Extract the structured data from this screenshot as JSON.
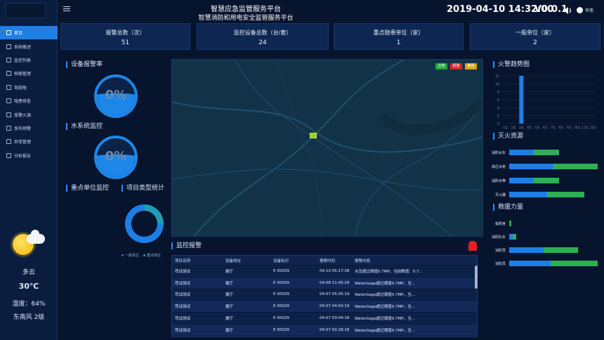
{
  "sidebar": {
    "items": [
      {
        "label": "首页",
        "active": true
      },
      {
        "label": "系统概述"
      },
      {
        "label": "监控列表"
      },
      {
        "label": "档案管理"
      },
      {
        "label": "驾驶舱"
      },
      {
        "label": "隐患排查"
      },
      {
        "label": "接警火源"
      },
      {
        "label": "发布预警"
      },
      {
        "label": "异常管理"
      },
      {
        "label": "分析报告"
      }
    ]
  },
  "weather": {
    "condition": "多云",
    "temperature": "30℃",
    "humidity": "湿度：64%",
    "wind": "东南风 2级"
  },
  "header": {
    "title_line1": "智慧应急监管服务平台",
    "title_line2": "智慧消防和用电安全监管服务平台",
    "datetime": "2019-04-10 14:32:00",
    "version": "V0.0.1",
    "user": "华伟"
  },
  "stats": [
    {
      "label": "报警总数（次）",
      "value": "51"
    },
    {
      "label": "监控设备总数（台/套）",
      "value": "24"
    },
    {
      "label": "重点隐患单位（家）",
      "value": "1"
    },
    {
      "label": "一般单位（家）",
      "value": "2"
    }
  ],
  "left_panels": {
    "device_alarm_rate": {
      "title": "设备报警率",
      "value": "0%"
    },
    "water_monitor": {
      "title": "水系统监控",
      "value": "0%"
    },
    "key_unit_monitor": {
      "title": "重点单位监控"
    },
    "project_type_stats": {
      "title": "项目类型统计",
      "legend": [
        "一般单位",
        "重点单位"
      ]
    }
  },
  "map": {
    "legend": [
      {
        "label": "正常",
        "color": "#22a83a"
      },
      {
        "label": "报警",
        "color": "#d9262a"
      },
      {
        "label": "离线",
        "color": "#d9a51b"
      }
    ]
  },
  "alarm_table": {
    "title": "监控报警",
    "columns": [
      "项目名称",
      "设备地址",
      "设备标识",
      "报警时间",
      "报警内容"
    ],
    "rows": [
      [
        "苟试测试",
        "展厅",
        "E 00029",
        "04-10 05:17:38",
        "水压超过阈值0.7MP，当前数值：0.7..."
      ],
      [
        "苟试测试",
        "展厅",
        "E 00029",
        "04-08 11:45:29",
        "WaterGage超过阈值0.7MP，当..."
      ],
      [
        "苟试测试",
        "展厅",
        "E 00029",
        "04-07 05:05:19",
        "WaterGage超过阈值0.7MP，当..."
      ],
      [
        "苟试测试",
        "展厅",
        "E 00029",
        "04-07 04:50:19",
        "WaterGage超过阈值0.7MP，当..."
      ],
      [
        "苟试测试",
        "展厅",
        "E 00029",
        "04-07 03:04:18",
        "WaterGage超过阈值0.7MP，当..."
      ],
      [
        "苟试测试",
        "展厅",
        "E 00029",
        "04-07 02:28:18",
        "WaterGage超过阈值0.7MP，当..."
      ]
    ]
  },
  "right_panels": {
    "fire_trend": {
      "title": "火警趋势图",
      "y_ticks": [
        "12",
        "10",
        "8",
        "6",
        "4",
        "2",
        "0"
      ],
      "months": [
        "1月",
        "2月",
        "3月",
        "4月",
        "5月",
        "6月",
        "7月",
        "8月",
        "9月",
        "10月",
        "11月",
        "12月"
      ],
      "values": [
        0,
        0,
        12,
        0,
        0,
        0,
        0,
        0,
        0,
        0,
        0,
        0
      ],
      "ymax": 12
    },
    "fire_resources": {
      "title": "灭火资源",
      "items": [
        {
          "label": "消防水车",
          "blue": 0.28,
          "green": 0.28
        },
        {
          "label": "高压水枪",
          "blue": 0.5,
          "green": 0.5
        },
        {
          "label": "消防水带",
          "blue": 0.28,
          "green": 0.28
        },
        {
          "label": "灭火器",
          "blue": 0.43,
          "green": 0.42
        }
      ]
    },
    "rescue_force": {
      "title": "救援力量",
      "items": [
        {
          "label": "指挥官",
          "blue": 0.01,
          "green": 0.01
        },
        {
          "label": "消防队长",
          "blue": 0.04,
          "green": 0.04
        },
        {
          "label": "消防员",
          "blue": 0.39,
          "green": 0.39
        },
        {
          "label": "消防员",
          "blue": 0.47,
          "green": 0.53
        }
      ]
    }
  }
}
